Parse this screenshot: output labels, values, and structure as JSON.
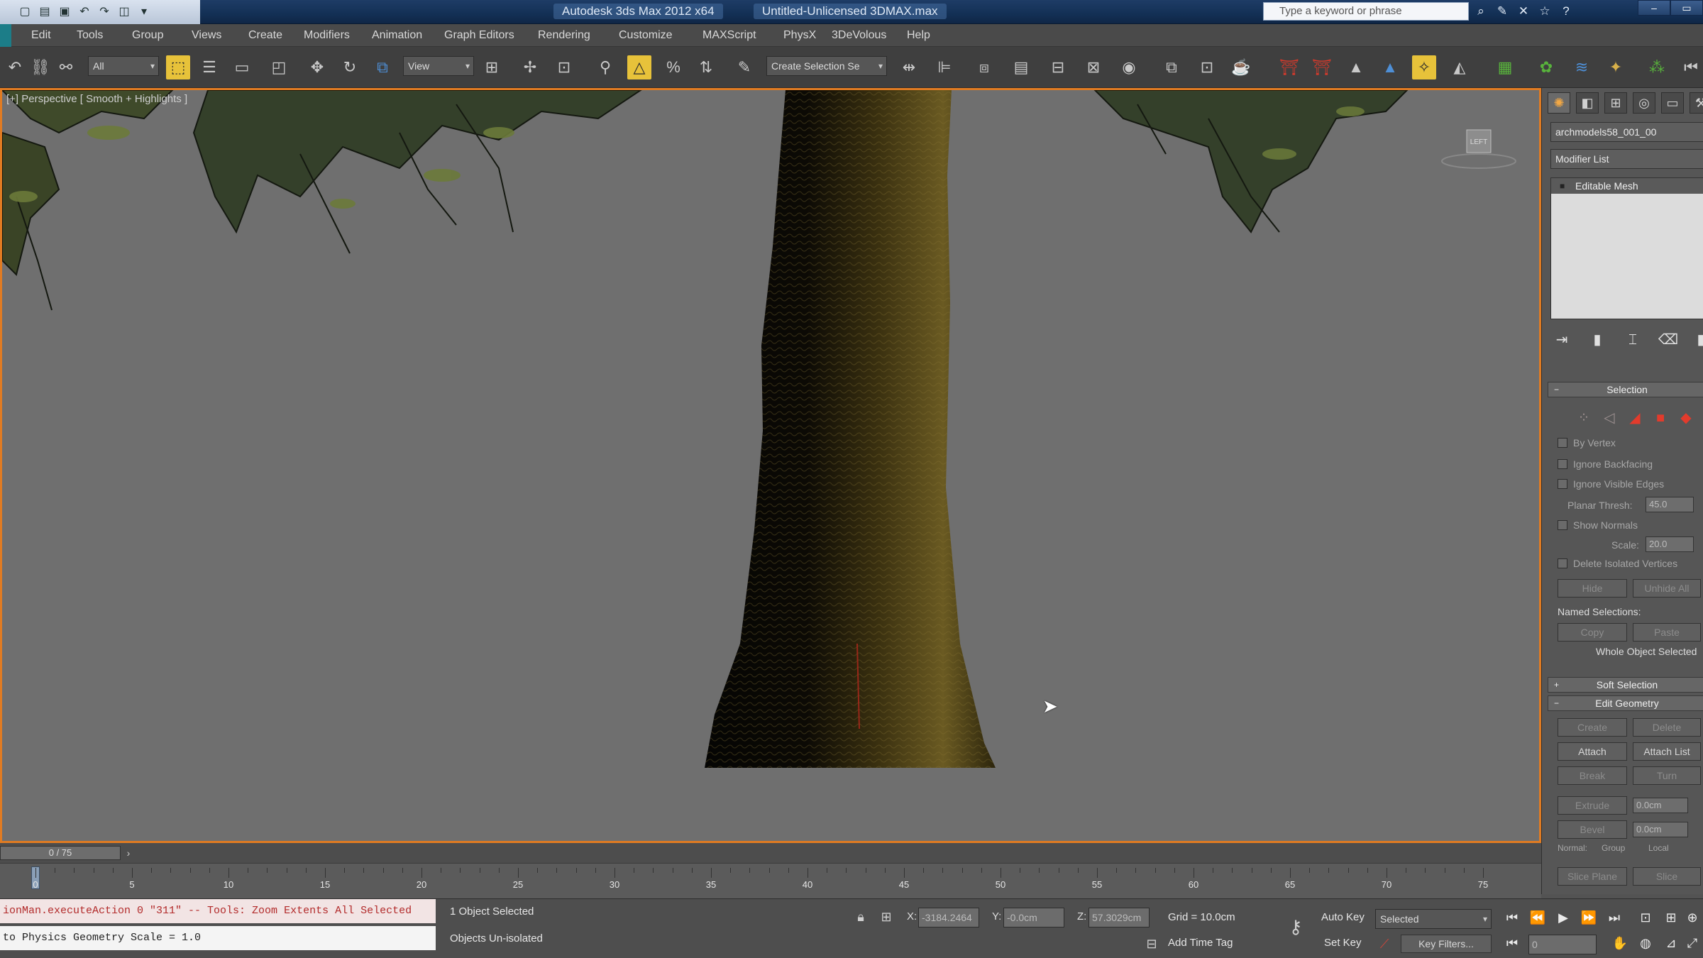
{
  "app": {
    "file_title": "Autodesk 3ds Max 2012 x64",
    "document_title": "Untitled-Unlicensed 3DMAX.max",
    "search_placeholder": "Type a keyword or phrase"
  },
  "menu": [
    "Edit",
    "Tools",
    "Group",
    "Views",
    "Create",
    "Modifiers",
    "Animation",
    "Graph Editors",
    "Rendering",
    "Customize",
    "MAXScript",
    "PhysX",
    "3DeVolous",
    "Help"
  ],
  "toolbar": {
    "filter_value": "All",
    "ref_coord_value": "View",
    "named_selection_placeholder": "Create Selection Se"
  },
  "viewport": {
    "label": "[+] Perspective [ Smooth + Highlights ]",
    "viewcube_label": "LEFT"
  },
  "command_panel": {
    "object_name": "archmodels58_001_00",
    "modifier_list": "Modifier List",
    "stack_item": "Editable Mesh",
    "selection_title": "Selection",
    "checkboxes": [
      "By Vertex",
      "Ignore Backfacing",
      "Ignore Visible Edges"
    ],
    "planar_thresh_label": "Planar Thresh:",
    "planar_thresh_value": "45.0",
    "show_normals_label": "Show Normals",
    "scale_label": "Scale:",
    "scale_value": "20.0",
    "delete_isolated_label": "Delete Isolated Vertices",
    "hide_button": "Hide",
    "unhide_all_button": "Unhide All",
    "named_selections_label": "Named Selections:",
    "copy_button": "Copy",
    "paste_button": "Paste",
    "whole_object_label": "Whole Object Selected",
    "soft_selection_title": "Soft Selection",
    "edit_geometry_title": "Edit Geometry",
    "create_button": "Create",
    "delete_button": "Delete",
    "attach_button": "Attach",
    "attach_list_button": "Attach List",
    "break_button": "Break",
    "turn_button": "Turn",
    "extrude_button": "Extrude",
    "extrude_value": "0.0cm",
    "bevel_button": "Bevel",
    "bevel_value": "0.0cm",
    "normal_label": "Normal:",
    "group_label": "Group",
    "local_label": "Local",
    "slice_plane_button": "Slice Plane",
    "slice_button": "Slice"
  },
  "timeline": {
    "frame_display": "0 / 75",
    "ticks": [
      0,
      5,
      10,
      15,
      20,
      25,
      30,
      35,
      40,
      45,
      50,
      55,
      60,
      65,
      70,
      75
    ],
    "current_frame": 0,
    "total_frames": 75
  },
  "status": {
    "listener_line1": "ionMan.executeAction 0 \"311\"  -- Tools: Zoom Extents All Selected",
    "listener_line2": "to Physics Geometry Scale = 1.0",
    "selection_info": "1 Object Selected",
    "prompt": "Objects Un-isolated",
    "x_value": "-3184.2464",
    "y_value": "-0.0cm",
    "z_value": "57.3029cm",
    "grid": "Grid = 10.0cm",
    "add_time_tag": "Add Time Tag",
    "auto_key": "Auto Key",
    "set_key": "Set Key",
    "selected_dropdown": "Selected",
    "key_filters": "Key Filters...",
    "frame_field": "0"
  },
  "colors": {
    "viewport_border": "#e07b22",
    "active_tool": "#e7c23a",
    "viewport_bg": "#6f6f6f"
  }
}
